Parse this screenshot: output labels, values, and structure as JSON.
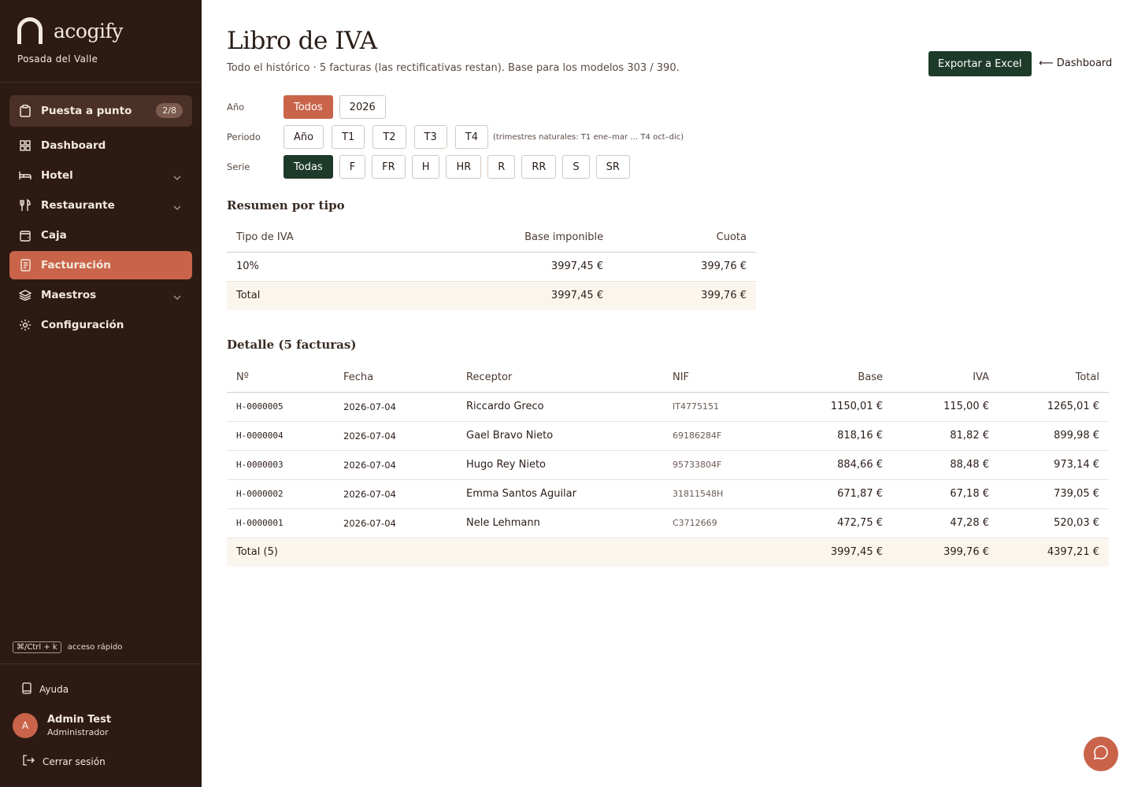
{
  "brand": {
    "name": "acogify",
    "property": "Posada del Valle"
  },
  "nav": {
    "setup": {
      "label": "Puesta a punto",
      "badge": "2/8"
    },
    "items": [
      {
        "label": "Dashboard",
        "icon": "grid-icon"
      },
      {
        "label": "Hotel",
        "icon": "bed-icon"
      },
      {
        "label": "Restaurante",
        "icon": "fork-knife-icon"
      },
      {
        "label": "Caja",
        "icon": "wallet-icon"
      },
      {
        "label": "Facturación",
        "icon": "document-icon"
      },
      {
        "label": "Maestros",
        "icon": "layers-icon"
      },
      {
        "label": "Configuración",
        "icon": "gear-icon"
      }
    ]
  },
  "shortcut": {
    "keys": "⌘/Ctrl + k",
    "label": "acceso rápido"
  },
  "footer": {
    "help": "Ayuda",
    "user_initial": "A",
    "user_name": "Admin Test",
    "user_role": "Administrador",
    "logout": "Cerrar sesión"
  },
  "page": {
    "title": "Libro de IVA",
    "subtitle": "Todo el histórico · 5 facturas (las rectificativas restan). Base para los modelos 303 / 390.",
    "export": "Exportar a Excel",
    "back": "⟵ Dashboard"
  },
  "filters": {
    "year_label": "Año",
    "years": [
      "Todos",
      "2026"
    ],
    "period_label": "Periodo",
    "periods": [
      "Año",
      "T1",
      "T2",
      "T3",
      "T4"
    ],
    "period_note": "(trimestres naturales: T1 ene–mar … T4 oct–dic)",
    "series_label": "Serie",
    "series": [
      "Todas",
      "F",
      "FR",
      "H",
      "HR",
      "R",
      "RR",
      "S",
      "SR"
    ]
  },
  "summary": {
    "title": "Resumen por tipo",
    "headers": [
      "Tipo de IVA",
      "Base imponible",
      "Cuota"
    ],
    "rows": [
      [
        "10%",
        "3997,45 €",
        "399,76 €"
      ]
    ],
    "total": [
      "Total",
      "3997,45 €",
      "399,76 €"
    ]
  },
  "detail": {
    "title": "Detalle (5 facturas)",
    "headers": [
      "Nº",
      "Fecha",
      "Receptor",
      "NIF",
      "Base",
      "IVA",
      "Total"
    ],
    "rows": [
      [
        "H-0000005",
        "2026-07-04",
        "Riccardo Greco",
        "IT4775151",
        "1150,01 €",
        "115,00 €",
        "1265,01 €"
      ],
      [
        "H-0000004",
        "2026-07-04",
        "Gael Bravo Nieto",
        "69186284F",
        "818,16 €",
        "81,82 €",
        "899,98 €"
      ],
      [
        "H-0000003",
        "2026-07-04",
        "Hugo Rey Nieto",
        "95733804F",
        "884,66 €",
        "88,48 €",
        "973,14 €"
      ],
      [
        "H-0000002",
        "2026-07-04",
        "Emma Santos Aguilar",
        "31811548H",
        "671,87 €",
        "67,18 €",
        "739,05 €"
      ],
      [
        "H-0000001",
        "2026-07-04",
        "Nele Lehmann",
        "C3712669",
        "472,75 €",
        "47,28 €",
        "520,03 €"
      ]
    ],
    "total": [
      "Total (5)",
      "3997,45 €",
      "399,76 €",
      "4397,21 €"
    ]
  },
  "colors": {
    "sidebar": "#2c1a13",
    "accent": "#c9644a",
    "primary": "#1e3a2a",
    "total_bg": "#faf6ee"
  }
}
